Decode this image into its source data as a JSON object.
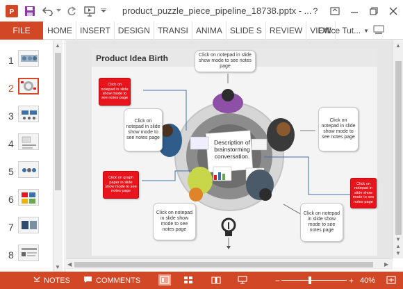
{
  "window": {
    "title": "product_puzzle_piece_pipeline_18738.pptx - ...",
    "help_label": "?"
  },
  "ribbon": {
    "file_label": "FILE",
    "tabs": [
      "HOME",
      "INSERT",
      "DESIGN",
      "TRANSI",
      "ANIMA",
      "SLIDE S",
      "REVIEW",
      "VIEW"
    ],
    "account_label": "Office Tut..."
  },
  "thumbnails": [
    {
      "num": "1",
      "active": false
    },
    {
      "num": "2",
      "active": true
    },
    {
      "num": "3",
      "active": false
    },
    {
      "num": "4",
      "active": false
    },
    {
      "num": "5",
      "active": false
    },
    {
      "num": "6",
      "active": false
    },
    {
      "num": "7",
      "active": false
    },
    {
      "num": "8",
      "active": false
    }
  ],
  "slide": {
    "title": "Product Idea Birth",
    "center_text": "Description of brainstorming conversation.",
    "notes": {
      "top": "Click on notepad in slide show mode to see notes page",
      "left": "Click on notepad in slide show mode to see notes page",
      "right": "Click on notepad in slide show mode to see notes page",
      "bottom_left": "Click on notepad in slide show mode to see notes page",
      "bottom_right": "Click on notepad in slide show mode to see notes page",
      "red_top_left": "Click on notepad in slide show mode to see notes page",
      "red_mid_left": "Click on graph paper in slide show mode to see notes page",
      "red_right": "Click on notepad in slide show mode to see notes page"
    }
  },
  "statusbar": {
    "notes_label": "NOTES",
    "comments_label": "COMMENTS",
    "zoom_minus": "−",
    "zoom_plus": "+",
    "zoom_value": "40%",
    "zoom_fraction": 0.4
  },
  "colors": {
    "accent": "#d24726",
    "red_note": "#e8141c",
    "connector": "#3f6fa8"
  }
}
